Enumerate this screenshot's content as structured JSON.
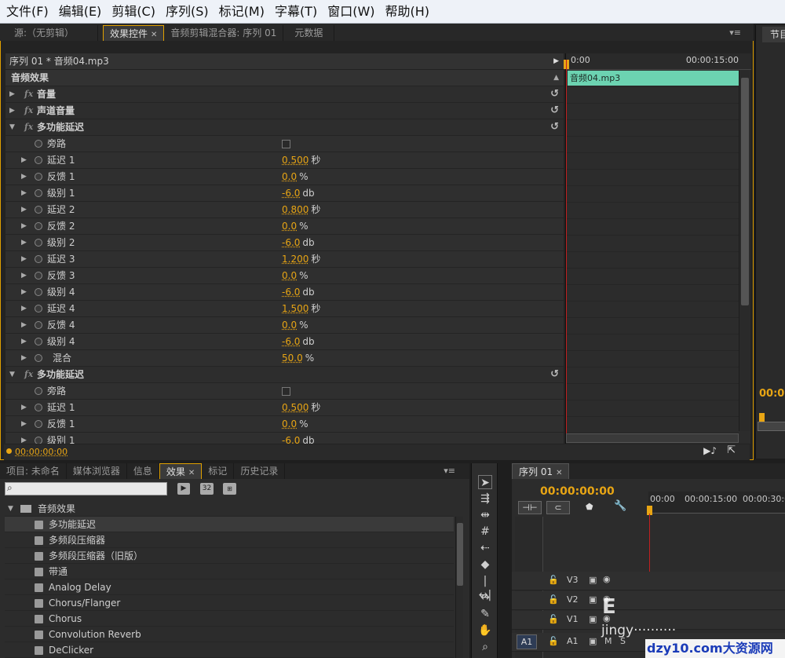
{
  "menu": [
    "文件(F)",
    "编辑(E)",
    "剪辑(C)",
    "序列(S)",
    "标记(M)",
    "字幕(T)",
    "窗口(W)",
    "帮助(H)"
  ],
  "top_tabs": [
    {
      "label": "源:（无剪辑）",
      "active": false,
      "closable": false
    },
    {
      "label": "效果控件",
      "active": true,
      "closable": true
    },
    {
      "label": "音频剪辑混合器: 序列 01",
      "active": false,
      "closable": false
    },
    {
      "label": "元数据",
      "active": false,
      "closable": false
    }
  ],
  "right_tab_label": "节目",
  "ec": {
    "header": "序列 01 * 音频04.mp3",
    "section_label": "音频效果",
    "rows": [
      {
        "kind": "fx",
        "label": "音量",
        "expanded": false
      },
      {
        "kind": "fx",
        "label": "声道音量",
        "expanded": false
      },
      {
        "kind": "fx",
        "label": "多功能延迟",
        "expanded": true
      },
      {
        "kind": "check",
        "label": "旁路"
      },
      {
        "kind": "param",
        "label": "延迟 1",
        "value": "0.500",
        "unit": "秒"
      },
      {
        "kind": "param",
        "label": "反馈 1",
        "value": "0.0",
        "unit": "%"
      },
      {
        "kind": "param",
        "label": "级别 1",
        "value": "-6.0",
        "unit": "db"
      },
      {
        "kind": "param",
        "label": "延迟 2",
        "value": "0.800",
        "unit": "秒"
      },
      {
        "kind": "param",
        "label": "反馈 2",
        "value": "0.0",
        "unit": "%"
      },
      {
        "kind": "param",
        "label": "级别 2",
        "value": "-6.0",
        "unit": "db"
      },
      {
        "kind": "param",
        "label": "延迟 3",
        "value": "1.200",
        "unit": "秒"
      },
      {
        "kind": "param",
        "label": "反馈 3",
        "value": "0.0",
        "unit": "%"
      },
      {
        "kind": "param",
        "label": "级别 4",
        "value": "-6.0",
        "unit": "db"
      },
      {
        "kind": "param",
        "label": "延迟 4",
        "value": "1.500",
        "unit": "秒"
      },
      {
        "kind": "param",
        "label": "反馈 4",
        "value": "0.0",
        "unit": "%"
      },
      {
        "kind": "param",
        "label": "级别 4",
        "value": "-6.0",
        "unit": "db"
      },
      {
        "kind": "mix",
        "label": "混合",
        "value": "50.0",
        "unit": "%"
      },
      {
        "kind": "fx",
        "label": "多功能延迟",
        "expanded": true
      },
      {
        "kind": "check",
        "label": "旁路"
      },
      {
        "kind": "param",
        "label": "延迟 1",
        "value": "0.500",
        "unit": "秒"
      },
      {
        "kind": "param",
        "label": "反馈 1",
        "value": "0.0",
        "unit": "%"
      },
      {
        "kind": "param",
        "label": "级别 1",
        "value": "-6.0",
        "unit": "db"
      }
    ],
    "ruler_start": "0:00",
    "ruler_end": "00:00:15:00",
    "clip_label": "音频04.mp3",
    "footer_time": "00:00:00:00"
  },
  "project": {
    "tabs": [
      {
        "label": "项目: 未命名",
        "active": false,
        "closable": false
      },
      {
        "label": "媒体浏览器",
        "active": false,
        "closable": false
      },
      {
        "label": "信息",
        "active": false,
        "closable": false
      },
      {
        "label": "效果",
        "active": true,
        "closable": true
      },
      {
        "label": "标记",
        "active": false,
        "closable": false
      },
      {
        "label": "历史记录",
        "active": false,
        "closable": false
      }
    ],
    "search_placeholder": "",
    "btn_32": "32",
    "folder": "音频效果",
    "items": [
      "多功能延迟",
      "多频段压缩器",
      "多频段压缩器（旧版）",
      "带通",
      "Analog Delay",
      "Chorus/Flanger",
      "Chorus",
      "Convolution Reverb",
      "DeClicker"
    ]
  },
  "timeline": {
    "tab": "序列 01",
    "timecode": "00:00:00:00",
    "ruler": [
      "00:00",
      "00:00:15:00",
      "00:00:30:0"
    ],
    "tracks": [
      "V3",
      "V2",
      "V1",
      "A1"
    ],
    "source_patch": "A1",
    "mute_label": "M",
    "solo_label": "S"
  },
  "watermark": {
    "left_text": "jingy",
    "right_text": "dzy10.com大资源网"
  },
  "colors": {
    "accent": "#e8a514",
    "clip": "#6cd3b1",
    "playhead": "#c02020"
  }
}
